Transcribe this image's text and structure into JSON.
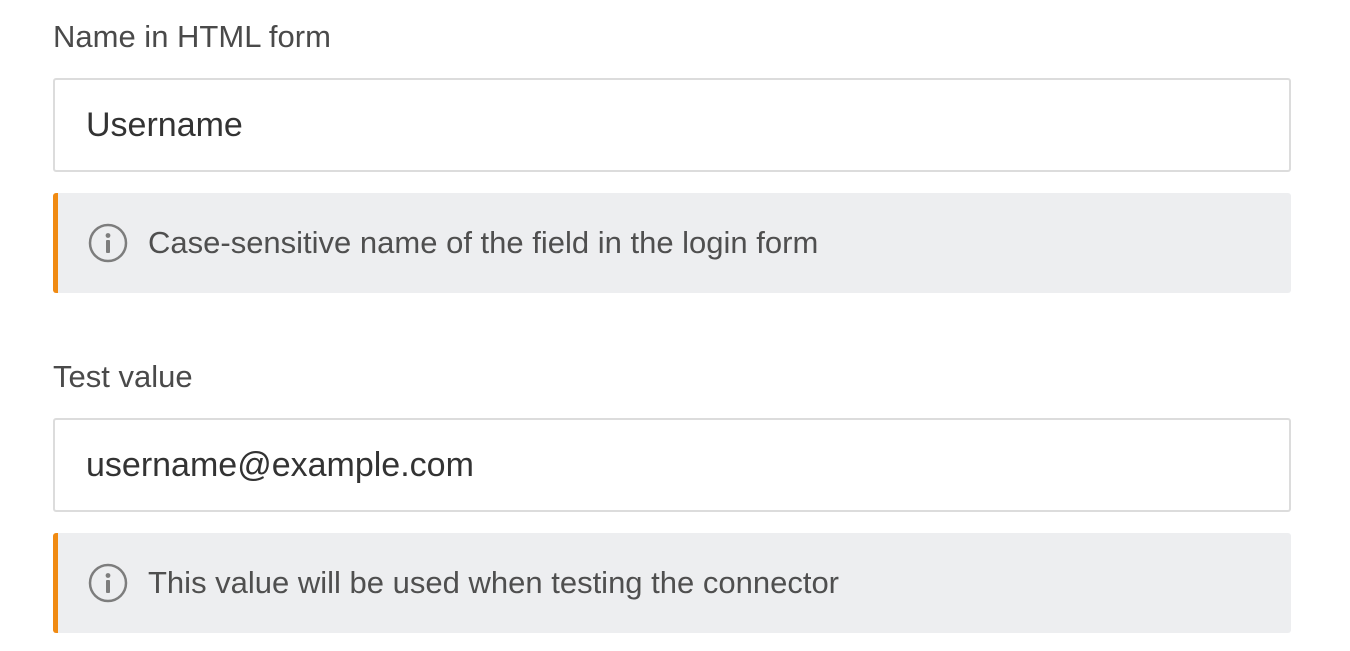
{
  "fields": [
    {
      "label": "Name in HTML form",
      "value": "Username",
      "hint": "Case-sensitive name of the field in the login form",
      "hint_icon": "info-icon"
    },
    {
      "label": "Test value",
      "value": "username@example.com",
      "hint": "This value will be used when testing the connector",
      "hint_icon": "info-icon"
    }
  ],
  "colors": {
    "accent": "#f08a12",
    "hint_background": "#edeef0",
    "input_border": "#dcdcdc",
    "label_text": "#4a4a4a"
  }
}
